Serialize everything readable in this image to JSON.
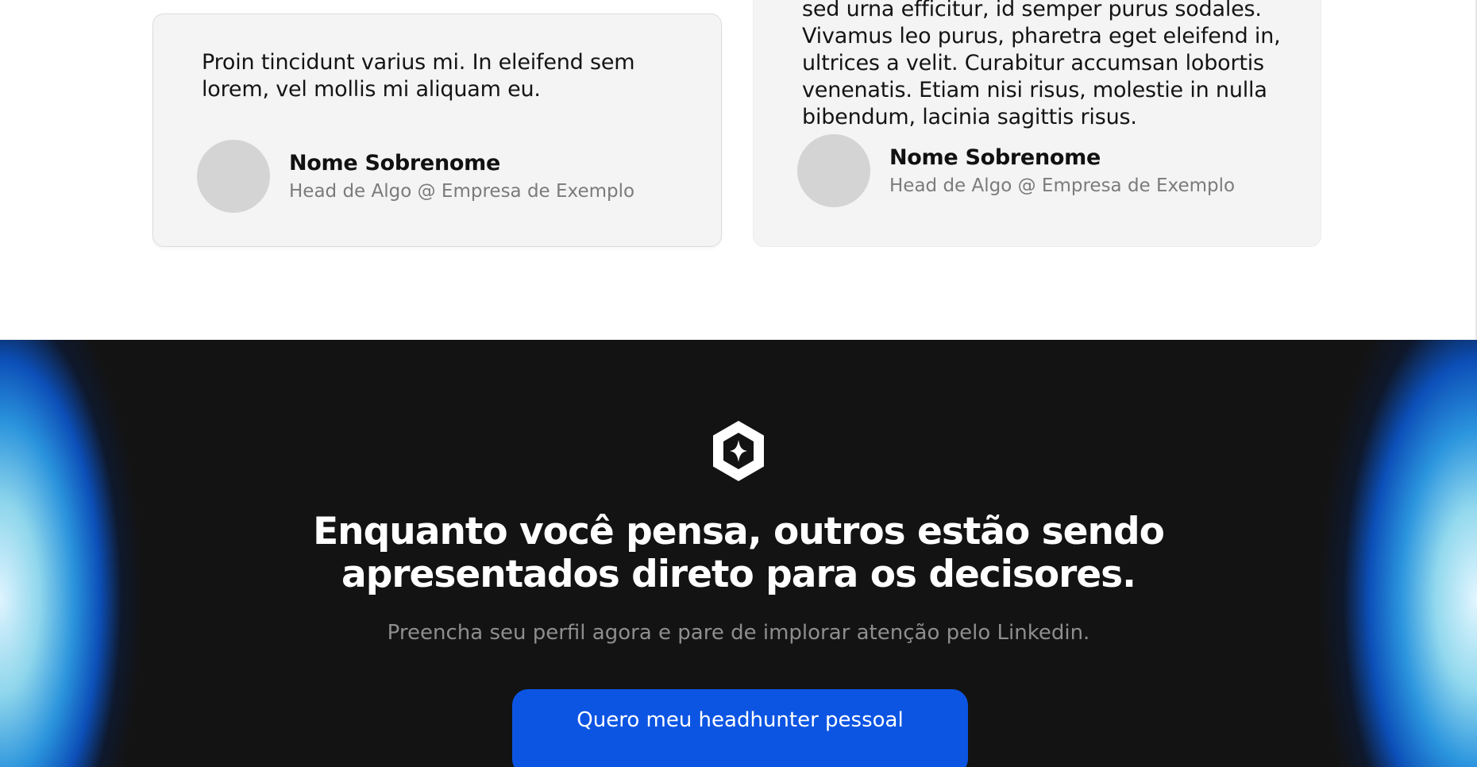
{
  "testimonials": [
    {
      "quote": "Proin tincidunt varius mi. In eleifend sem lorem, vel mollis mi aliquam eu.",
      "name": "Nome Sobrenome",
      "role": "Head de Algo @ Empresa de Exemplo"
    },
    {
      "quote": "sed urna efficitur, id semper purus sodales. Vivamus leo purus, pharetra eget eleifend in, ultrices a velit. Curabitur accumsan lobortis venenatis. Etiam nisi risus, molestie in nulla bibendum, lacinia sagittis risus.",
      "name": "Nome Sobrenome",
      "role": "Head de Algo @ Empresa de Exemplo"
    }
  ],
  "cta": {
    "logo_icon": "hexagon-star-icon",
    "title": "Enquanto você pensa, outros estão sendo apresentados direto para os decisores.",
    "subtitle": "Preencha seu perfil agora e pare de implorar atenção pelo Linkedin.",
    "button_label": "Quero meu headhunter pessoal"
  },
  "colors": {
    "card_background": "#f4f4f4",
    "avatar_placeholder": "#d4d4d4",
    "cta_background": "#131313",
    "button": "#0c55e3",
    "glow": "#2a93dc"
  }
}
